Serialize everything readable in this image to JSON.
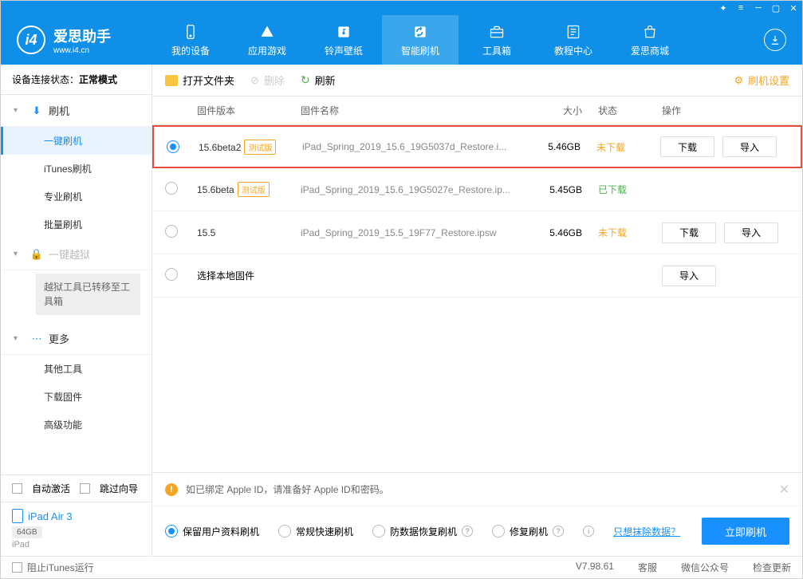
{
  "titlebar": {
    "icons": [
      "settings",
      "list",
      "minimize",
      "maximize",
      "close"
    ]
  },
  "header": {
    "logo_title": "爱思助手",
    "logo_sub": "www.i4.cn",
    "tabs": [
      {
        "label": "我的设备",
        "icon": "device"
      },
      {
        "label": "应用游戏",
        "icon": "apps"
      },
      {
        "label": "铃声壁纸",
        "icon": "music"
      },
      {
        "label": "智能刷机",
        "icon": "refresh",
        "active": true
      },
      {
        "label": "工具箱",
        "icon": "toolbox"
      },
      {
        "label": "教程中心",
        "icon": "tutorial"
      },
      {
        "label": "爱思商城",
        "icon": "store"
      }
    ]
  },
  "sidebar": {
    "status_label": "设备连接状态：",
    "status_value": "正常模式",
    "sections": [
      {
        "title": "刷机",
        "icon": "flash",
        "items": [
          {
            "label": "一键刷机",
            "active": true
          },
          {
            "label": "iTunes刷机"
          },
          {
            "label": "专业刷机"
          },
          {
            "label": "批量刷机"
          }
        ]
      },
      {
        "title": "一键越狱",
        "icon": "lock",
        "disabled": true,
        "note": "越狱工具已转移至工具箱"
      },
      {
        "title": "更多",
        "icon": "more",
        "items": [
          {
            "label": "其他工具"
          },
          {
            "label": "下载固件"
          },
          {
            "label": "高级功能"
          }
        ]
      }
    ],
    "auto_activate": "自动激活",
    "skip_guide": "跳过向导",
    "device_name": "iPad Air 3",
    "device_storage": "64GB",
    "device_type": "iPad"
  },
  "toolbar": {
    "open_folder": "打开文件夹",
    "delete": "删除",
    "refresh": "刷新",
    "settings": "刷机设置"
  },
  "table": {
    "headers": {
      "version": "固件版本",
      "name": "固件名称",
      "size": "大小",
      "status": "状态",
      "actions": "操作"
    },
    "rows": [
      {
        "selected": true,
        "highlighted": true,
        "version": "15.6beta2",
        "beta": "测试版",
        "name": "iPad_Spring_2019_15.6_19G5037d_Restore.i...",
        "size": "5.46GB",
        "status": "未下载",
        "status_class": "notdl",
        "download": "下载",
        "import": "导入"
      },
      {
        "version": "15.6beta",
        "beta": "测试版",
        "name": "iPad_Spring_2019_15.6_19G5027e_Restore.ip...",
        "size": "5.45GB",
        "status": "已下载",
        "status_class": "dl"
      },
      {
        "version": "15.5",
        "name": "iPad_Spring_2019_15.5_19F77_Restore.ipsw",
        "size": "5.46GB",
        "status": "未下载",
        "status_class": "notdl",
        "download": "下载",
        "import": "导入"
      },
      {
        "local": true,
        "label": "选择本地固件",
        "import": "导入"
      }
    ]
  },
  "bottom": {
    "warning": "如已绑定 Apple ID，请准备好 Apple ID和密码。",
    "options": [
      {
        "label": "保留用户资料刷机",
        "selected": true
      },
      {
        "label": "常规快速刷机"
      },
      {
        "label": "防数据恢复刷机",
        "info": true
      },
      {
        "label": "修复刷机",
        "info": true
      }
    ],
    "erase_link": "只想抹除数据？",
    "flash_btn": "立即刷机"
  },
  "statusbar": {
    "block_itunes": "阻止iTunes运行",
    "version": "V7.98.61",
    "items": [
      "客服",
      "微信公众号",
      "检查更新"
    ]
  }
}
